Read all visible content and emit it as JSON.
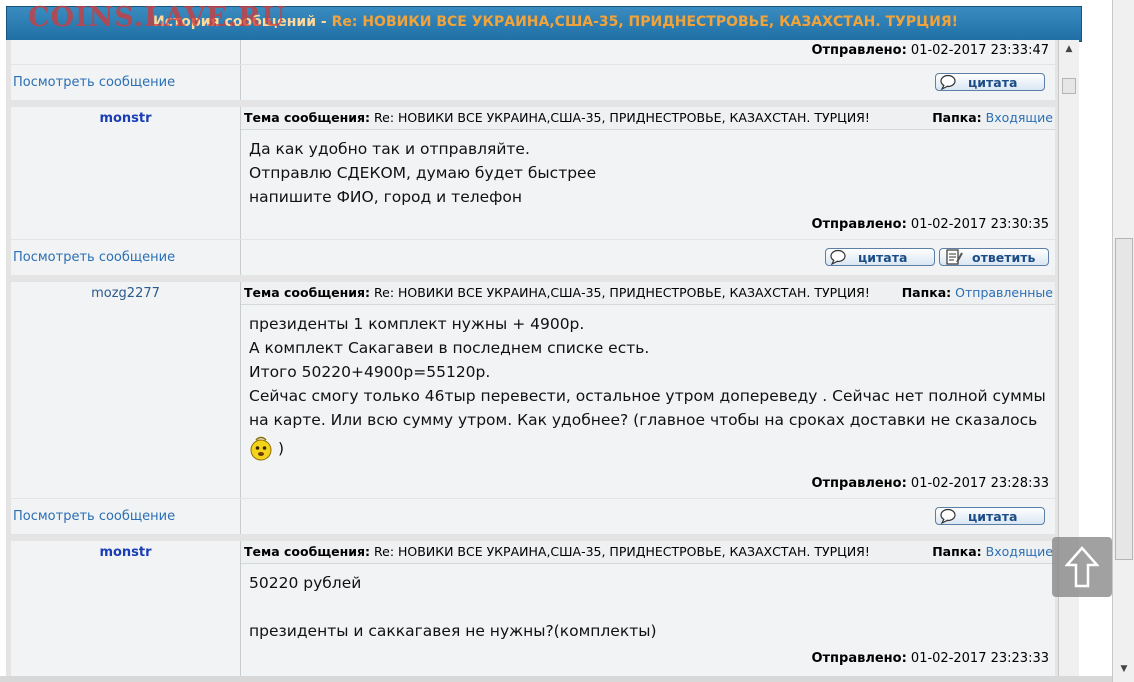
{
  "watermark": "COINS.LAVE.RU",
  "header": {
    "prefix": "История сообщений - ",
    "subject": "Re: НОВИКИ ВСЕ УКРАИНА,США-35, ПРИДНЕСТРОВЬЕ, КАЗАХСТАН. ТУРЦИЯ!"
  },
  "labels": {
    "topic": "Тема сообщения:",
    "folder": "Папка:",
    "sent": "Отправлено:",
    "view": "Посмотреть сообщение",
    "quote": "цитата",
    "reply": "ответить"
  },
  "messages": [
    {
      "sent": "01-02-2017 23:33:47"
    },
    {
      "author": "monstr",
      "subject": "Re: НОВИКИ ВСЕ УКРАИНА,США-35, ПРИДНЕСТРОВЬЕ, КАЗАХСТАН. ТУРЦИЯ!",
      "folder": "Входящие",
      "lines": [
        "Да как удобно так и отправляйте.",
        "Отправлю СДЕКОМ, думаю будет быстрее",
        "напишите ФИО, город и телефон"
      ],
      "sent": "01-02-2017 23:30:35"
    },
    {
      "author": "mozg2277",
      "subject": "Re: НОВИКИ ВСЕ УКРАИНА,США-35, ПРИДНЕСТРОВЬЕ, КАЗАХСТАН. ТУРЦИЯ!",
      "folder": "Отправленные",
      "lines": [
        "президенты 1 комплект нужны + 4900р.",
        "А комплект Сакагавеи в последнем списке есть.",
        "Итого 50220+4900р=55120р.",
        "Сейчас смогу только 46тыр перевести, остальное утром допереведу . Сейчас нет полной суммы",
        "на карте. Или всю сумму утром. Как удобнее? (главное чтобы на сроках доставки не сказалось"
      ],
      "tail": ")",
      "sent": "01-02-2017 23:28:33"
    },
    {
      "author": "monstr",
      "subject": "Re: НОВИКИ ВСЕ УКРАИНА,США-35, ПРИДНЕСТРОВЬЕ, КАЗАХСТАН. ТУРЦИЯ!",
      "folder": "Входящие",
      "lines": [
        "50220 рублей",
        "",
        "президенты и саккагавея не нужны?(комплекты)"
      ],
      "sent": "01-02-2017 23:23:33"
    }
  ]
}
